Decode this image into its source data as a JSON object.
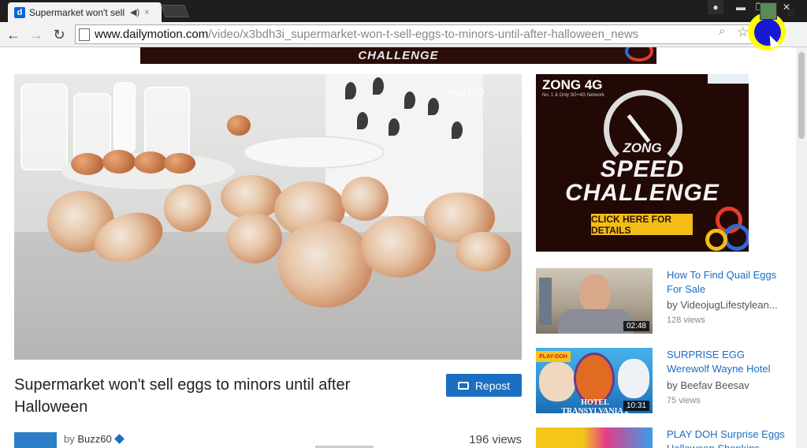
{
  "browser": {
    "tab": {
      "favicon_letter": "d",
      "title": "Supermarket won't sell eg",
      "audio_icon": "speaker-icon",
      "close_icon": "×"
    },
    "window_controls": {
      "user": "●",
      "minimize": "▬",
      "restore": "❐",
      "close": "✕"
    },
    "nav": {
      "back": "←",
      "forward": "→",
      "reload": "↻"
    },
    "address": {
      "host": "www.dailymotion.com",
      "path": "/video/x3bdh3i_supermarket-won-t-sell-eggs-to-minors-until-after-halloween_news"
    },
    "icons": {
      "zoom": "🔍",
      "star": "☆",
      "menu": "≡"
    }
  },
  "top_banner": {
    "text": "CHALLENGE"
  },
  "video": {
    "watermark": "buzz60",
    "title": "Supermarket won't sell eggs to minors until after Halloween",
    "repost_label": "Repost",
    "byline_prefix": "by",
    "owner": "Buzz60",
    "views": "196 views"
  },
  "ad": {
    "brand": "ZONG 4G",
    "sub": "No. 1 & Only 3G+4G Network",
    "line1": "ZONG",
    "line2": "SPEED",
    "line3": "CHALLENGE",
    "cta": "CLICK HERE FOR DETAILS"
  },
  "related": [
    {
      "title": "How To Find Quail Eggs For Sale",
      "channel": "by VideojugLifestylean...",
      "views": "128 views",
      "duration": "02:48"
    },
    {
      "title": "SURPRISE EGG Werewolf Wayne Hotel",
      "channel": "by Beefav Beesav",
      "views": "75 views",
      "duration": "10:31",
      "thumb_caption": "HOTEL TRANSYLVANIA 2",
      "thumb_brand": "PLAY-DOH"
    },
    {
      "title": "PLAY DOH Surprise Eggs Halloween Shopkins"
    }
  ]
}
